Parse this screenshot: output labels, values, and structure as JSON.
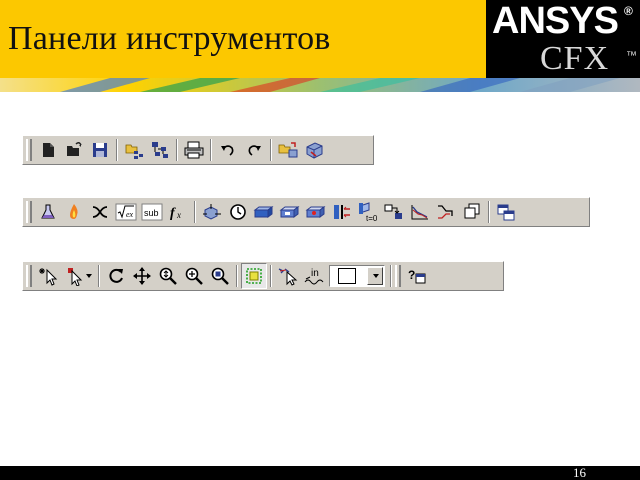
{
  "slide": {
    "title": "Панели инструментов",
    "page_number": "16"
  },
  "logo": {
    "brand": "ANSYS",
    "registered_mark": "®",
    "product": "CFX",
    "trademark": "™"
  },
  "colors": {
    "header": "#fcc800",
    "toolbar": "#d4d0c8",
    "footer": "#000000"
  },
  "toolbars": [
    {
      "name": "standard",
      "icons": [
        "new-icon",
        "open-icon",
        "save-icon",
        "open-case-icon",
        "save-case-icon",
        "print-icon",
        "undo-icon",
        "redo-icon",
        "import-icon",
        "export-icon"
      ]
    },
    {
      "name": "insert",
      "icons": [
        "material-icon",
        "reaction-icon",
        "additional-variable-icon",
        "expression-icon",
        "user-routine-icon",
        "user-function-icon",
        "domain-icon",
        "simulation-control-icon",
        "boundary-icon",
        "subdomain-icon",
        "source-point-icon",
        "interface-icon",
        "initialization-icon",
        "solver-control-icon",
        "output-control-icon",
        "monitor-icon",
        "mesh-adaption-icon",
        "define-run-icon"
      ]
    },
    {
      "name": "viewer",
      "icons": [
        "select-icon",
        "pick-icon",
        "rotate-icon",
        "pan-icon",
        "zoom-icon",
        "zoom-box-icon",
        "fit-view-icon",
        "highlight-icon",
        "show-faces-icon",
        "label-icon",
        "color-combo",
        "help-icon"
      ]
    }
  ]
}
